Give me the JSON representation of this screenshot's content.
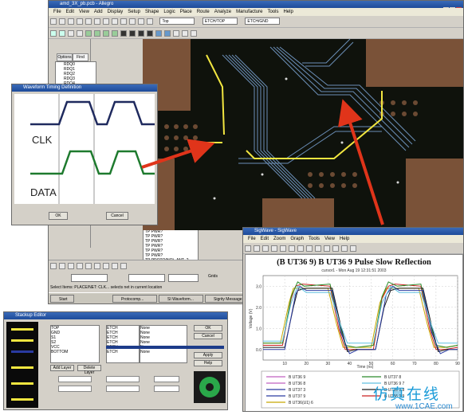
{
  "layout_window": {
    "title": "amd_3X_pb.pcb - Allegro",
    "menu": [
      "File",
      "Edit",
      "View",
      "Add",
      "Display",
      "Setup",
      "Shape",
      "Logic",
      "Place",
      "Route",
      "Analyze",
      "Manufacture",
      "Tools",
      "Help"
    ],
    "toolbar_combos": [
      "Top",
      "ETCH/TOP",
      "ETCH/GND"
    ],
    "side_tabs": [
      "Options",
      "Find"
    ],
    "side_list": [
      "RDQ0",
      "RDQ1",
      "RDQ2",
      "RDQ3",
      "RDQ4",
      "RDQ5"
    ],
    "net_list": [
      "TP PWR?",
      "TP PWR?",
      "TP PWR?",
      "TP PWR?",
      "TP PWR?",
      "TP PWR?",
      "TP PROTO(NO)_ANT_2"
    ],
    "coord_boxes": [
      "",
      "",
      ""
    ],
    "grids_label": "Grids",
    "status_text": "Select Items: PLACE/NET: CLK... selects net in current location",
    "taskbar_items": [
      "Start",
      "Protocomp...",
      "SI Waveform...",
      "Sigrity Message"
    ]
  },
  "timing_dialog": {
    "title": "Waveform Timing Definition",
    "signals": [
      "CLK",
      "DATA"
    ],
    "ok_label": "OK",
    "cancel_label": "Cancel"
  },
  "sigwave_window": {
    "title": "SigWave - SigWave",
    "menu": [
      "File",
      "Edit",
      "Zoom",
      "Graph",
      "Tools",
      "View",
      "Help"
    ],
    "chart_title": "(B UT36 9) B UT36 9 Pulse Slow Reflection",
    "chart_subtitle": "cursor1 - Mon Aug 19 12:31:51 2003",
    "xlabel": "Time (ns)",
    "ylabel": "Voltage (V)",
    "legend": [
      "B UT36 9",
      "B UT36 8",
      "B UT37 3",
      "B UT37 9",
      "B UT36(U1) 6",
      "B UT37 8",
      "B UT36 9 7",
      "B UT36 9 8",
      "B UT36 9 9"
    ]
  },
  "stackup_dialog": {
    "title": "Stackup Editor",
    "list1": [
      "TOP",
      "GND",
      "S1",
      "S2",
      "VCC",
      "BOTTOM"
    ],
    "list2": [
      "ETCH",
      "ETCH",
      "ETCH",
      "ETCH",
      "ETCH",
      "ETCH"
    ],
    "list3": [
      "None",
      "None",
      "None",
      "None",
      "None",
      "None"
    ],
    "buttons": [
      "Add Layer",
      "Delete Layer",
      "OK",
      "Cancel",
      "Apply",
      "Help"
    ]
  },
  "watermark": {
    "chinese": "仿真在线",
    "site": "www.1CAE.com"
  },
  "chart_data": {
    "type": "line",
    "title": "(B UT36 9) B UT36 9 Pulse Slow Reflection",
    "xlabel": "Time (ns)",
    "ylabel": "Voltage (V)",
    "xlim": [
      0,
      90
    ],
    "ylim": [
      -0.5,
      3.5
    ],
    "x_ticks": [
      "10",
      "20",
      "30",
      "40",
      "50",
      "60",
      "70",
      "80",
      "90"
    ],
    "y_ticks": [
      "0.0",
      "1.0",
      "2.0",
      "3.0"
    ],
    "series": [
      {
        "name": "B UT36 9",
        "color": "#c8a800",
        "x": [
          0,
          8,
          12,
          14,
          18,
          30,
          34,
          37,
          42,
          50,
          54,
          57,
          61,
          72,
          76,
          79,
          84,
          90
        ],
        "y": [
          0.3,
          0.3,
          2.2,
          2.9,
          2.9,
          2.9,
          1.2,
          0.1,
          0.1,
          0.1,
          2.2,
          2.9,
          2.9,
          2.9,
          1.2,
          0.1,
          0.1,
          0.2
        ]
      },
      {
        "name": "B UT36 8",
        "color": "#cc2222",
        "x": [
          0,
          9,
          13,
          15,
          18,
          31,
          35,
          38,
          42,
          51,
          55,
          58,
          61,
          73,
          77,
          80,
          84,
          90
        ],
        "y": [
          0.2,
          0.2,
          2.4,
          3.0,
          3.1,
          3.0,
          1.0,
          0.0,
          0.0,
          0.0,
          2.4,
          3.0,
          3.1,
          3.0,
          1.0,
          0.0,
          0.0,
          0.1
        ]
      },
      {
        "name": "B UT37 3",
        "color": "#2a8a2a",
        "x": [
          0,
          9,
          13,
          16,
          19,
          31,
          35,
          38,
          43,
          51,
          55,
          58,
          62,
          73,
          77,
          80,
          85,
          90
        ],
        "y": [
          0.3,
          0.3,
          2.5,
          3.2,
          3.0,
          3.1,
          1.3,
          0.2,
          0.1,
          0.2,
          2.5,
          3.2,
          3.0,
          3.1,
          1.3,
          0.2,
          0.1,
          0.2
        ]
      },
      {
        "name": "B UT37 9",
        "color": "#1a1a1a",
        "x": [
          0,
          10,
          14,
          16,
          20,
          32,
          36,
          39,
          43,
          52,
          56,
          59,
          63,
          74,
          78,
          81,
          85,
          90
        ],
        "y": [
          0.1,
          0.1,
          2.0,
          2.8,
          2.9,
          2.9,
          1.1,
          -0.1,
          0.0,
          0.0,
          2.0,
          2.8,
          2.9,
          2.9,
          1.1,
          -0.1,
          0.0,
          0.0
        ]
      },
      {
        "name": "B UT36(U1) 6",
        "color": "#2a3aa0",
        "x": [
          0,
          10,
          15,
          17,
          20,
          32,
          36,
          40,
          44,
          52,
          57,
          60,
          63,
          74,
          78,
          82,
          86,
          90
        ],
        "y": [
          0.0,
          0.0,
          2.6,
          3.0,
          2.8,
          2.8,
          0.8,
          -0.2,
          0.0,
          0.0,
          2.6,
          3.0,
          2.8,
          2.8,
          0.8,
          -0.2,
          0.0,
          0.0
        ]
      },
      {
        "name": "B UT37 8",
        "color": "#60c0e0",
        "x": [
          0,
          9,
          13,
          16,
          20,
          31,
          35,
          39,
          43,
          51,
          55,
          59,
          63,
          73,
          77,
          81,
          85,
          90
        ],
        "y": [
          0.4,
          0.4,
          2.2,
          3.0,
          2.7,
          2.7,
          1.4,
          0.3,
          0.3,
          0.3,
          2.2,
          3.0,
          2.7,
          2.7,
          1.4,
          0.3,
          0.3,
          0.3
        ]
      }
    ]
  }
}
